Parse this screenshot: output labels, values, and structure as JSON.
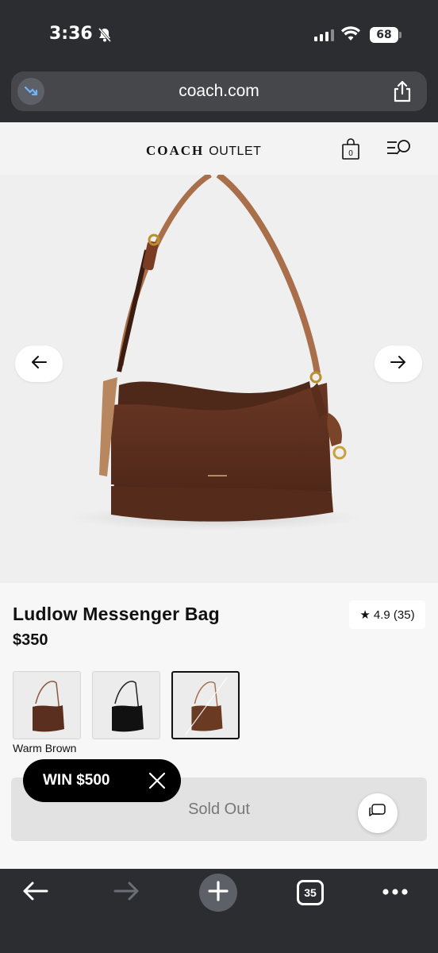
{
  "status_bar": {
    "time": "3:36",
    "battery": "68"
  },
  "browser": {
    "url": "coach.com",
    "tab_count": "35"
  },
  "site": {
    "logo_brand": "COACH",
    "logo_sub": "OUTLET",
    "cart_count": "0"
  },
  "product": {
    "title": "Ludlow Messenger Bag",
    "price": "$350",
    "rating": "4.9 (35)",
    "selected_color": "Warm Brown",
    "swatches": [
      {
        "color": "#5b2f1f"
      },
      {
        "color": "#111111"
      },
      {
        "color": "#6a3a22"
      }
    ],
    "cta": "Sold Out"
  },
  "promo": {
    "label": "WIN $500"
  },
  "colors": {
    "chrome": "#2b2d30",
    "bag_brown": "#5e301f",
    "strap": "#a86f4a"
  }
}
